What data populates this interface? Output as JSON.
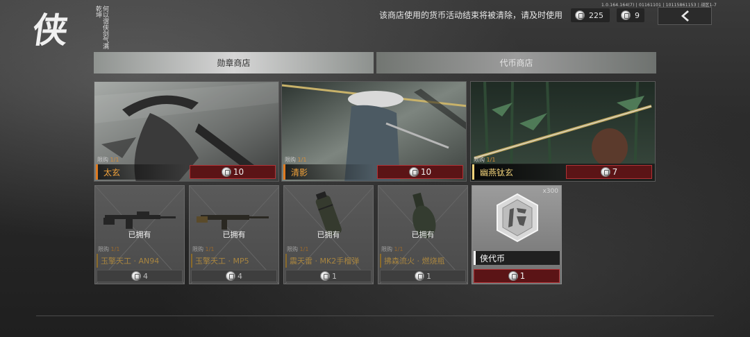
{
  "header": {
    "version": "1.0.164.164(7) | 01161101 | 10115861153 | 战区1-7",
    "logo_char": "侠",
    "logo_verse": "何以谓侠剑气满乾坤",
    "notice": "该商店使用的货币活动结束将被清除，请及时使用",
    "medal_count": "225",
    "token_count": "9",
    "icons": {
      "currency": "coin-icon",
      "back": "back-arrow-icon"
    }
  },
  "tabs": [
    {
      "label": "勋章商店",
      "active": true
    },
    {
      "label": "代币商店",
      "active": false
    }
  ],
  "heroes": [
    {
      "limit_label": "限购",
      "limit_value": "1/1",
      "name": "太玄",
      "price": "10"
    },
    {
      "limit_label": "限购",
      "limit_value": "1/1",
      "name": "清影",
      "price": "10"
    },
    {
      "limit_label": "限购",
      "limit_value": "1/1",
      "name": "幽燕钛玄",
      "price": "7"
    }
  ],
  "items": [
    {
      "status": "已拥有",
      "limit_label": "限购",
      "limit_value": "1/1",
      "name": "玉擎天工 · AN94",
      "price": "4"
    },
    {
      "status": "已拥有",
      "limit_label": "限购",
      "limit_value": "1/1",
      "name": "玉擎天工 · MP5",
      "price": "4"
    },
    {
      "status": "已拥有",
      "limit_label": "限购",
      "limit_value": "1/1",
      "name": "震天雷 · MK2手榴弹",
      "price": "1"
    },
    {
      "status": "已拥有",
      "limit_label": "限购",
      "limit_value": "1/1",
      "name": "拂森流火 · 燃烧瓶",
      "price": "1"
    }
  ],
  "token_item": {
    "quantity": "x300",
    "name": "侠代币",
    "price": "1"
  },
  "colors": {
    "price_red": "#5b1416",
    "accent_orange": "#e07a1f",
    "gold": "#f1d27a"
  }
}
